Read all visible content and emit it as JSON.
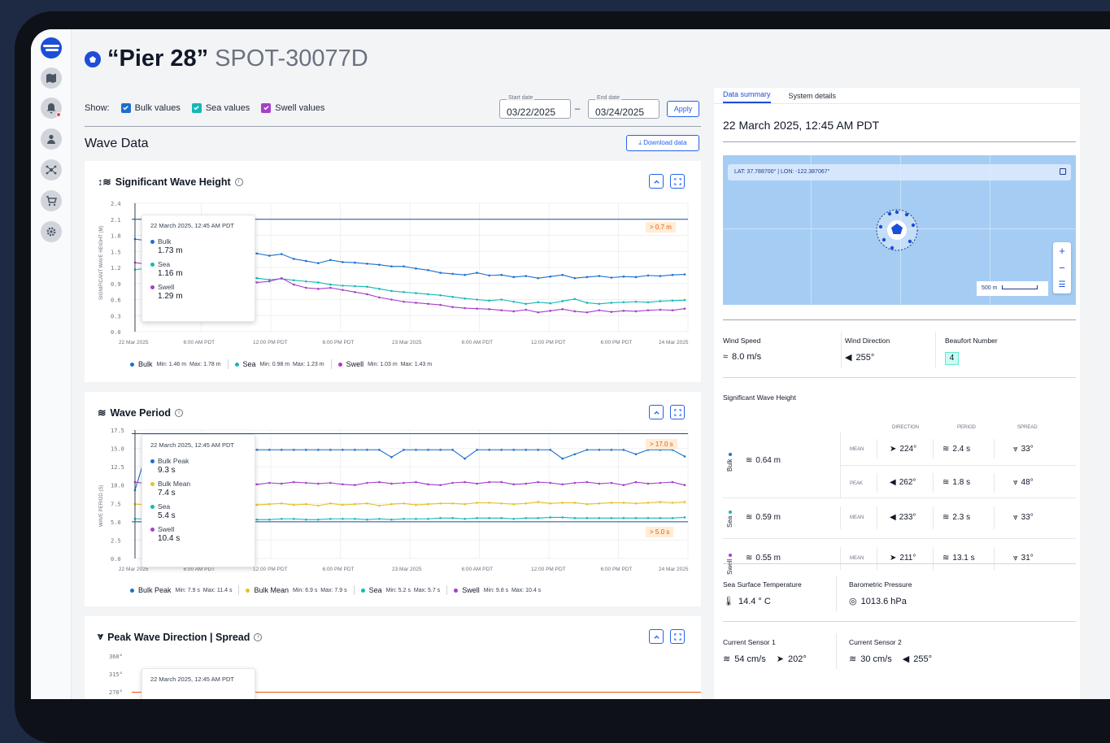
{
  "header": {
    "quoted_name": "“Pier 28”",
    "device_id": "SPOT-30077D"
  },
  "filters": {
    "show_label": "Show:",
    "bulk_label": "Bulk values",
    "sea_label": "Sea values",
    "swell_label": "Swell values",
    "start_label": "Start date",
    "start_value": "03/22/2025",
    "end_label": "End date",
    "end_value": "03/24/2025",
    "dash": "–",
    "apply_label": "Apply"
  },
  "section": {
    "title": "Wave Data",
    "download_label": "Download data"
  },
  "colors": {
    "bulk": "#1d6fcf",
    "sea": "#14b8b8",
    "swell": "#a63fc9",
    "mean": "#e6c12a",
    "accent": "#2563eb",
    "threshold": "#ea580c"
  },
  "x_ticks": [
    "22 Mar 2025",
    "6:00 AM PDT",
    "12:00 PM PDT",
    "6:00 PM PDT",
    "23 Mar 2025",
    "6:00 AM PDT",
    "12:00 PM PDT",
    "6:00 PM PDT",
    "24 Mar 2025"
  ],
  "swh_chart": {
    "title": "Significant Wave Height",
    "ylabel": "SIGNIFICANT WAVE HEIGHT (M)",
    "y_ticks": [
      "2.4",
      "2.1",
      "1.8",
      "1.5",
      "1.2",
      "0.9",
      "0.6",
      "0.3",
      "0.0"
    ],
    "threshold": "> 0.7 m",
    "tooltip": {
      "time": "22 March 2025, 12:45 AM PDT",
      "items": [
        {
          "name": "Bulk",
          "value": "1.73 m"
        },
        {
          "name": "Sea",
          "value": "1.16 m"
        },
        {
          "name": "Swell",
          "value": "1.29 m"
        }
      ]
    },
    "legend": [
      {
        "name": "Bulk",
        "min_label": "Min:",
        "min": "1.46 m",
        "max_label": "Max:",
        "max": "1.78 m"
      },
      {
        "name": "Sea",
        "min_label": "Min:",
        "min": "0.98 m",
        "max_label": "Max:",
        "max": "1.23 m"
      },
      {
        "name": "Swell",
        "min_label": "Min:",
        "min": "1.03 m",
        "max_label": "Max:",
        "max": "1.43 m"
      }
    ]
  },
  "period_chart": {
    "title": "Wave Period",
    "ylabel": "WAVE PERIOD (S)",
    "y_ticks": [
      "17.5",
      "15.0",
      "12.5",
      "10.0",
      "7.5",
      "5.0",
      "2.5",
      "0.0"
    ],
    "threshold_high": "> 17.0 s",
    "threshold_low": "> 5.0 s",
    "tooltip": {
      "time": "22 March 2025, 12:45 AM PDT",
      "items": [
        {
          "name": "Bulk Peak",
          "value": "9.3 s"
        },
        {
          "name": "Bulk Mean",
          "value": "7.4 s"
        },
        {
          "name": "Sea",
          "value": "5.4 s"
        },
        {
          "name": "Swell",
          "value": "10.4 s"
        }
      ]
    },
    "legend": [
      {
        "name": "Bulk Peak",
        "min_label": "Min:",
        "min": "7.9 s",
        "max_label": "Max:",
        "max": "11.4 s"
      },
      {
        "name": "Bulk Mean",
        "min_label": "Min:",
        "min": "6.9 s",
        "max_label": "Max:",
        "max": "7.9 s"
      },
      {
        "name": "Sea",
        "min_label": "Min:",
        "min": "5.2 s",
        "max_label": "Max:",
        "max": "5.7 s"
      },
      {
        "name": "Swell",
        "min_label": "Min:",
        "min": "9.8 s",
        "max_label": "Max:",
        "max": "10.4 s"
      }
    ]
  },
  "direction_chart": {
    "title": "Peak Wave Direction | Spread",
    "y_ticks": [
      "360°",
      "315°",
      "270°"
    ],
    "tooltip_time": "22 March 2025, 12:45 AM PDT"
  },
  "chart_data": [
    {
      "type": "line",
      "title": "Significant Wave Height",
      "ylabel": "SIGNIFICANT WAVE HEIGHT (M)",
      "ylim": [
        0,
        2.4
      ],
      "series": [
        {
          "name": "Bulk",
          "values": [
            1.73,
            1.7,
            1.62,
            1.55,
            1.5,
            1.52,
            1.48,
            1.47,
            1.46,
            1.49,
            1.46,
            1.42,
            1.45,
            1.36,
            1.32,
            1.28,
            1.34,
            1.3,
            1.29,
            1.27,
            1.25,
            1.22,
            1.22,
            1.18,
            1.15,
            1.1,
            1.08,
            1.06,
            1.1,
            1.05,
            1.06,
            1.02,
            1.04,
            1.0,
            1.03,
            1.06,
            1.0,
            1.02,
            1.04,
            1.01,
            1.03,
            1.02,
            1.05,
            1.04,
            1.06,
            1.07
          ]
        },
        {
          "name": "Sea",
          "values": [
            1.16,
            1.18,
            1.14,
            1.1,
            1.06,
            1.02,
            1.04,
            1.03,
            1.0,
            0.98,
            1.0,
            0.97,
            0.99,
            0.96,
            0.94,
            0.92,
            0.88,
            0.86,
            0.85,
            0.84,
            0.8,
            0.76,
            0.74,
            0.72,
            0.7,
            0.68,
            0.65,
            0.62,
            0.6,
            0.58,
            0.6,
            0.56,
            0.52,
            0.55,
            0.53,
            0.57,
            0.61,
            0.54,
            0.52,
            0.54,
            0.55,
            0.56,
            0.55,
            0.57,
            0.58,
            0.59
          ]
        },
        {
          "name": "Swell",
          "values": [
            1.29,
            1.26,
            1.2,
            1.1,
            1.06,
            0.98,
            1.02,
            0.95,
            0.93,
            0.97,
            0.92,
            0.94,
            1.0,
            0.88,
            0.82,
            0.8,
            0.82,
            0.78,
            0.74,
            0.7,
            0.64,
            0.6,
            0.56,
            0.54,
            0.52,
            0.5,
            0.46,
            0.44,
            0.43,
            0.42,
            0.4,
            0.38,
            0.41,
            0.36,
            0.39,
            0.42,
            0.38,
            0.36,
            0.4,
            0.37,
            0.39,
            0.38,
            0.4,
            0.41,
            0.4,
            0.43
          ]
        }
      ]
    },
    {
      "type": "line",
      "title": "Wave Period",
      "ylabel": "WAVE PERIOD (S)",
      "ylim": [
        0,
        17.5
      ],
      "series": [
        {
          "name": "Bulk Peak",
          "values": [
            9.3,
            14.8,
            14.8,
            14.8,
            14.8,
            14.8,
            14.8,
            14.8,
            14.8,
            14.8,
            14.8,
            14.8,
            14.8,
            14.8,
            14.8,
            14.8,
            14.8,
            14.8,
            14.8,
            14.8,
            14.8,
            13.8,
            14.8,
            14.8,
            14.8,
            14.8,
            14.8,
            13.6,
            14.8,
            14.8,
            14.8,
            14.8,
            14.8,
            14.8,
            14.8,
            13.6,
            14.2,
            14.8,
            14.8,
            14.8,
            14.8,
            14.2,
            14.8,
            14.8,
            14.8,
            13.9
          ]
        },
        {
          "name": "Bulk Mean",
          "values": [
            7.4,
            7.3,
            7.2,
            7.0,
            7.1,
            7.2,
            7.2,
            7.3,
            7.2,
            7.4,
            7.3,
            7.4,
            7.5,
            7.3,
            7.4,
            7.2,
            7.5,
            7.3,
            7.4,
            7.5,
            7.2,
            7.4,
            7.5,
            7.3,
            7.4,
            7.5,
            7.5,
            7.4,
            7.6,
            7.6,
            7.5,
            7.4,
            7.5,
            7.7,
            7.5,
            7.6,
            7.6,
            7.4,
            7.5,
            7.6,
            7.6,
            7.5,
            7.6,
            7.7,
            7.6,
            7.7
          ]
        },
        {
          "name": "Sea",
          "values": [
            5.4,
            5.4,
            5.3,
            5.3,
            5.2,
            5.3,
            5.3,
            5.3,
            5.2,
            5.3,
            5.3,
            5.3,
            5.4,
            5.4,
            5.3,
            5.3,
            5.4,
            5.4,
            5.4,
            5.3,
            5.4,
            5.3,
            5.4,
            5.4,
            5.4,
            5.5,
            5.5,
            5.4,
            5.5,
            5.5,
            5.5,
            5.4,
            5.5,
            5.5,
            5.6,
            5.6,
            5.5,
            5.5,
            5.5,
            5.5,
            5.5,
            5.5,
            5.5,
            5.5,
            5.5,
            5.6
          ]
        },
        {
          "name": "Swell",
          "values": [
            10.4,
            10.2,
            10.2,
            10.3,
            10.3,
            10.1,
            10.0,
            10.2,
            10.3,
            10.2,
            10.1,
            10.3,
            10.2,
            10.4,
            10.3,
            10.2,
            10.3,
            10.1,
            10.0,
            10.3,
            10.4,
            10.2,
            10.3,
            10.4,
            10.1,
            10.0,
            10.3,
            10.4,
            10.2,
            10.4,
            10.4,
            10.1,
            10.2,
            10.4,
            10.3,
            10.1,
            10.3,
            10.4,
            10.2,
            10.3,
            10.0,
            10.4,
            10.2,
            10.3,
            10.4,
            10.0
          ]
        }
      ]
    }
  ],
  "summary": {
    "tab_summary": "Data summary",
    "tab_system": "System details",
    "datetime": "22 March 2025, 12:45 AM PDT",
    "map": {
      "coords": "LAT: 37.788700° | LON: -122.387067°",
      "scale": "500 m",
      "zoom_in": "+",
      "zoom_out": "−"
    },
    "wind_speed_label": "Wind Speed",
    "wind_speed": "8.0 m/s",
    "wind_dir_label": "Wind Direction",
    "wind_dir": "255°",
    "beaufort_label": "Beaufort Number",
    "beaufort": "4",
    "swh_label": "Significant Wave Height",
    "col_direction": "DIRECTION",
    "col_period": "PERIOD",
    "col_spread": "SPREAD",
    "bulk": {
      "label": "Bulk",
      "height": "0.64 m",
      "mean": {
        "label": "MEAN",
        "dir": "224°",
        "period": "2.4 s",
        "spread": "33°"
      },
      "peak": {
        "label": "PEAK",
        "dir": "262°",
        "period": "1.8 s",
        "spread": "48°"
      }
    },
    "sea": {
      "label": "Sea",
      "height": "0.59 m",
      "mean_label": "MEAN",
      "dir": "233°",
      "period": "2.3 s",
      "spread": "33°"
    },
    "swell": {
      "label": "Swell",
      "height": "0.55 m",
      "mean_label": "MEAN",
      "dir": "211°",
      "period": "13.1 s",
      "spread": "31°"
    },
    "sst_label": "Sea Surface Temperature",
    "sst": "14.4 ° C",
    "baro_label": "Barometric Pressure",
    "baro": "1013.6 hPa",
    "cur1_label": "Current Sensor 1",
    "cur1_speed": "54 cm/s",
    "cur1_dir": "202°",
    "cur2_label": "Current Sensor 2",
    "cur2_speed": "30 cm/s",
    "cur2_dir": "255°"
  }
}
